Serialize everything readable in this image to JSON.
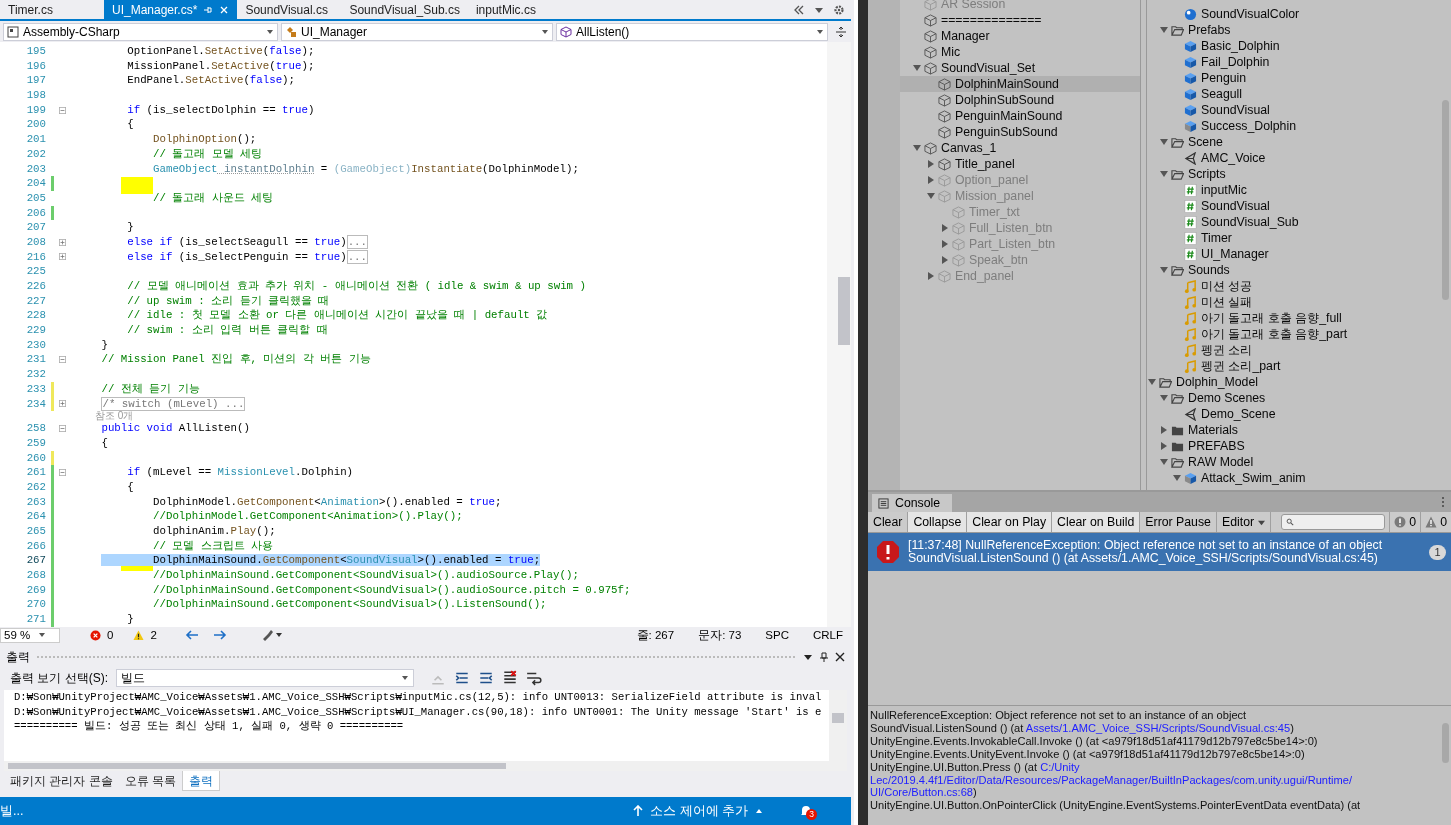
{
  "editor_tabs": [
    {
      "label": "Timer.cs",
      "selected": false
    },
    {
      "label": "UI_Manager.cs*",
      "selected": true
    },
    {
      "label": "SoundVisual.cs",
      "selected": false
    },
    {
      "label": "SoundVisual_Sub.cs",
      "selected": false
    },
    {
      "label": "inputMic.cs",
      "selected": false
    }
  ],
  "nav_bar": {
    "project": "Assembly-CSharp",
    "class": "UI_Manager",
    "member": "AllListen()"
  },
  "code": {
    "lines": [
      {
        "number": "195",
        "selected": false,
        "marked": false,
        "tokens": [
          {
            "kind": "p",
            "text": "    OptionPanel."
          },
          {
            "kind": "m",
            "text": "SetActive"
          },
          {
            "kind": "p",
            "text": "("
          },
          {
            "kind": "k",
            "text": "false"
          },
          {
            "kind": "p",
            "text": ");"
          }
        ]
      },
      {
        "number": "196",
        "selected": false,
        "marked": false,
        "tokens": [
          {
            "kind": "p",
            "text": "    MissionPanel."
          },
          {
            "kind": "m",
            "text": "SetActive"
          },
          {
            "kind": "p",
            "text": "("
          },
          {
            "kind": "k",
            "text": "true"
          },
          {
            "kind": "p",
            "text": ");"
          }
        ]
      },
      {
        "number": "197",
        "selected": false,
        "marked": false,
        "tokens": [
          {
            "kind": "p",
            "text": "    EndPanel."
          },
          {
            "kind": "m",
            "text": "SetActive"
          },
          {
            "kind": "p",
            "text": "("
          },
          {
            "kind": "k",
            "text": "false"
          },
          {
            "kind": "p",
            "text": ");"
          }
        ]
      },
      {
        "number": "198",
        "selected": false,
        "marked": false
      },
      {
        "number": "199",
        "selected": false,
        "marked": false,
        "collapsed": false,
        "tokens": [
          {
            "kind": "k",
            "text": "    if"
          },
          {
            "kind": "p",
            "text": " (is_selectDolphin == "
          },
          {
            "kind": "k",
            "text": "true"
          },
          {
            "kind": "p",
            "text": ")"
          }
        ]
      },
      {
        "number": "200",
        "selected": false,
        "marked": false,
        "tokens": [
          {
            "kind": "p",
            "text": "    {"
          }
        ]
      },
      {
        "number": "201",
        "selected": false,
        "marked": false,
        "tokens": [
          {
            "kind": "m",
            "text": "        DolphinOption"
          },
          {
            "kind": "p",
            "text": "();"
          }
        ]
      },
      {
        "number": "202",
        "selected": false,
        "marked": false,
        "tokens": [
          {
            "kind": "c",
            "text": "        // 돌고래 모델 세팅"
          }
        ]
      },
      {
        "number": "203",
        "selected": false,
        "marked": false,
        "tokens": [
          {
            "kind": "t",
            "text": "        GameObject"
          },
          {
            "kind": "u",
            "text": " instantDolphin"
          },
          {
            "kind": "p",
            "text": " = "
          },
          {
            "kind": "f",
            "text": "(GameObject)"
          },
          {
            "kind": "m",
            "text": "Instantiate"
          },
          {
            "kind": "p",
            "text": "(DolphinModel);"
          }
        ]
      },
      {
        "number": "204",
        "selected": false,
        "marked": true,
        "saved": true
      },
      {
        "number": "205",
        "selected": false,
        "marked": false,
        "tokens": [
          {
            "kind": "c",
            "text": "        // 돌고래 사운드 세팅"
          }
        ]
      },
      {
        "number": "206",
        "selected": false,
        "marked": false,
        "saved": true
      },
      {
        "number": "207",
        "selected": false,
        "marked": false,
        "tokens": [
          {
            "kind": "p",
            "text": "    }"
          }
        ]
      },
      {
        "number": "208",
        "selected": false,
        "marked": false,
        "collapsed": true,
        "tokens": [
          {
            "kind": "k",
            "text": "    else if"
          },
          {
            "kind": "p",
            "text": " (is_selectSeagull == "
          },
          {
            "kind": "k",
            "text": "true"
          },
          {
            "kind": "p",
            "text": ")"
          },
          {
            "kind": "x",
            "text": "..."
          }
        ]
      },
      {
        "number": "216",
        "selected": false,
        "marked": false,
        "collapsed": true,
        "tokens": [
          {
            "kind": "k",
            "text": "    else if"
          },
          {
            "kind": "p",
            "text": " (is_SelectPenguin == "
          },
          {
            "kind": "k",
            "text": "true"
          },
          {
            "kind": "p",
            "text": ")"
          },
          {
            "kind": "x",
            "text": "..."
          }
        ]
      },
      {
        "number": "225",
        "selected": false,
        "marked": false
      },
      {
        "number": "226",
        "selected": false,
        "marked": false,
        "tokens": [
          {
            "kind": "c",
            "text": "    // 모델 애니메이션 효과 추가 위치 - 애니메이션 전환 ( idle & swim & up swim )"
          }
        ]
      },
      {
        "number": "227",
        "selected": false,
        "marked": false,
        "tokens": [
          {
            "kind": "c",
            "text": "    // up swim : 소리 듣기 클릭했을 때"
          }
        ]
      },
      {
        "number": "228",
        "selected": false,
        "marked": false,
        "tokens": [
          {
            "kind": "c",
            "text": "    // idle : 첫 모델 소환 or 다른 애니메이션 시간이 끝났을 때 | default 값"
          }
        ]
      },
      {
        "number": "229",
        "selected": false,
        "marked": false,
        "tokens": [
          {
            "kind": "c",
            "text": "    // swim : 소리 입력 버튼 클릭할 때"
          }
        ]
      },
      {
        "number": "230",
        "selected": false,
        "marked": false,
        "tokens": [
          {
            "kind": "p",
            "text": "}"
          }
        ]
      },
      {
        "number": "231",
        "selected": false,
        "marked": false,
        "collapsed": false,
        "tokens": [
          {
            "kind": "c",
            "text": "// Mission Panel 진입 후, 미션의 각 버튼 기능"
          }
        ]
      },
      {
        "number": "232",
        "selected": false,
        "marked": false
      },
      {
        "number": "233",
        "selected": false,
        "marked": false,
        "saved": false,
        "tokens": [
          {
            "kind": "c",
            "text": "// 전체 듣기 기능"
          }
        ]
      },
      {
        "number": "234",
        "selected": false,
        "marked": false,
        "saved": false,
        "collapsed": true,
        "tokens": [
          {
            "kind": "x",
            "text": "/* switch (mLevel) ..."
          }
        ]
      },
      {
        "number": "258",
        "selected": false,
        "marked": false,
        "collapsed": false,
        "codelens": "참조 0개",
        "tokens": [
          {
            "kind": "k",
            "text": "public void"
          },
          {
            "kind": "p",
            "text": " AllListen()"
          }
        ]
      },
      {
        "number": "259",
        "selected": false,
        "marked": false,
        "tokens": [
          {
            "kind": "p",
            "text": "{"
          }
        ]
      },
      {
        "number": "260",
        "selected": false,
        "marked": false,
        "saved": false
      },
      {
        "number": "261",
        "selected": false,
        "marked": false,
        "saved": true,
        "collapsed": false,
        "tokens": [
          {
            "kind": "k",
            "text": "    if"
          },
          {
            "kind": "p",
            "text": " (mLevel == "
          },
          {
            "kind": "t",
            "text": "MissionLevel"
          },
          {
            "kind": "p",
            "text": ".Dolphin)"
          }
        ]
      },
      {
        "number": "262",
        "selected": false,
        "marked": false,
        "saved": true,
        "tokens": [
          {
            "kind": "p",
            "text": "    {"
          }
        ]
      },
      {
        "number": "263",
        "selected": false,
        "marked": false,
        "saved": true,
        "tokens": [
          {
            "kind": "p",
            "text": "        DolphinModel."
          },
          {
            "kind": "m",
            "text": "GetComponent"
          },
          {
            "kind": "p",
            "text": "<"
          },
          {
            "kind": "t",
            "text": "Animation"
          },
          {
            "kind": "p",
            "text": ">().enabled = "
          },
          {
            "kind": "k",
            "text": "true"
          },
          {
            "kind": "p",
            "text": ";"
          }
        ]
      },
      {
        "number": "264",
        "selected": false,
        "marked": false,
        "saved": true,
        "tokens": [
          {
            "kind": "c",
            "text": "        //DolphinModel.GetComponent<Animation>().Play();"
          }
        ]
      },
      {
        "number": "265",
        "selected": false,
        "marked": false,
        "saved": true,
        "tokens": [
          {
            "kind": "p",
            "text": "        dolphinAnim."
          },
          {
            "kind": "m",
            "text": "Play"
          },
          {
            "kind": "p",
            "text": "();"
          }
        ]
      },
      {
        "number": "266",
        "selected": false,
        "marked": false,
        "saved": true,
        "tokens": [
          {
            "kind": "c",
            "text": "        // 모델 스크립트 사용"
          }
        ]
      },
      {
        "number": "267",
        "selected": true,
        "marked": true,
        "saved": true,
        "tokens": [
          {
            "kind": "p",
            "text": "        DolphinMainSound."
          },
          {
            "kind": "m",
            "text": "GetComponent"
          },
          {
            "kind": "p",
            "text": "<"
          },
          {
            "kind": "t",
            "text": "SoundVisual"
          },
          {
            "kind": "p",
            "text": ">().enabled = "
          },
          {
            "kind": "k",
            "text": "true"
          },
          {
            "kind": "p",
            "text": ";"
          }
        ]
      },
      {
        "number": "268",
        "selected": false,
        "marked": false,
        "saved": true,
        "tokens": [
          {
            "kind": "c",
            "text": "        //DolphinMainSound.GetComponent<SoundVisual>().audioSource.Play();"
          }
        ]
      },
      {
        "number": "269",
        "selected": false,
        "marked": false,
        "saved": true,
        "tokens": [
          {
            "kind": "c",
            "text": "        //DolphinMainSound.GetComponent<SoundVisual>().audioSource.pitch = 0.975f;"
          }
        ]
      },
      {
        "number": "270",
        "selected": false,
        "marked": false,
        "saved": true,
        "tokens": [
          {
            "kind": "c",
            "text": "        //DolphinMainSound.GetComponent<SoundVisual>().ListenSound();"
          }
        ]
      },
      {
        "number": "271",
        "selected": false,
        "marked": false,
        "saved": true,
        "tokens": [
          {
            "kind": "p",
            "text": "    }"
          }
        ]
      }
    ]
  },
  "editor_status": {
    "zoom": "59 %",
    "errors": "0",
    "warnings": "2",
    "line": "줄: 267",
    "column": "문자: 73",
    "spacing": "SPC",
    "line_ending": "CRLF"
  },
  "output": {
    "title": "출력",
    "source_label": "출력 보기 선택(S):",
    "source": "빌드",
    "lines": [
      "D:₩Son₩UnityProject₩AMC_Voice₩Assets₩1.AMC_Voice_SSH₩Scripts₩inputMic.cs(12,5): info UNT0013: SerializeField attribute is inval",
      "D:₩Son₩UnityProject₩AMC_Voice₩Assets₩1.AMC_Voice_SSH₩Scripts₩UI_Manager.cs(90,18): info UNT0001: The Unity message 'Start' is e",
      "========== 빌드: 성공 또는 최신 상태 1, 실패 0, 생략 0 =========="
    ],
    "tabs": [
      {
        "label": "패키지 관리자 콘솔",
        "selected": false
      },
      {
        "label": "오류 목록",
        "selected": false
      },
      {
        "label": "출력",
        "selected": true
      }
    ]
  },
  "status_bar": {
    "message": "빌...",
    "source_control": "소스 제어에 추가",
    "notifications": "3"
  },
  "hierarchy": {
    "tree": [
      {
        "children": [
          {
            "name": "AR Session",
            "active": false,
            "selected": false
          },
          {
            "name": "==============",
            "active": true,
            "selected": false
          },
          {
            "name": "Manager",
            "active": true,
            "selected": false
          },
          {
            "name": "Mic",
            "active": true,
            "selected": false
          },
          {
            "name": "SoundVisual_Set",
            "active": true,
            "selected": false,
            "expanded": true,
            "children": [
              {
                "name": "DolphinMainSound",
                "active": true,
                "selected": true
              },
              {
                "name": "DolphinSubSound",
                "active": true,
                "selected": false
              },
              {
                "name": "PenguinMainSound",
                "active": true,
                "selected": false
              },
              {
                "name": "PenguinSubSound",
                "active": true,
                "selected": false
              }
            ]
          },
          {
            "name": "Canvas_1",
            "active": true,
            "selected": false,
            "expanded": true,
            "children": [
              {
                "name": "Title_panel",
                "active": true,
                "selected": false,
                "expanded": false
              },
              {
                "name": "Option_panel",
                "active": false,
                "selected": false,
                "expanded": false
              },
              {
                "name": "Mission_panel",
                "active": false,
                "selected": false,
                "expanded": true,
                "children": [
                  {
                    "name": "Timer_txt",
                    "active": false,
                    "selected": false
                  },
                  {
                    "name": "Full_Listen_btn",
                    "active": false,
                    "selected": false,
                    "expanded": false
                  },
                  {
                    "name": "Part_Listen_btn",
                    "active": false,
                    "selected": false,
                    "expanded": false
                  },
                  {
                    "name": "Speak_btn",
                    "active": false,
                    "selected": false,
                    "expanded": false
                  }
                ]
              },
              {
                "name": "End_panel",
                "active": false,
                "selected": false,
                "expanded": false
              }
            ]
          }
        ]
      }
    ]
  },
  "project": {
    "tree": [
      {
        "children": [
          {
            "children": [
              {
                "kind": "material",
                "name": "SoundVisualColor"
              }
            ]
          },
          {
            "kind": "folder",
            "name": "Prefabs",
            "expanded": true,
            "children": [
              {
                "kind": "prefab",
                "name": "Basic_Dolphin"
              },
              {
                "kind": "prefab",
                "name": "Fail_Dolphin"
              },
              {
                "kind": "prefab",
                "name": "Penguin"
              },
              {
                "kind": "prefab",
                "name": "Seagull"
              },
              {
                "kind": "prefab",
                "name": "SoundVisual"
              },
              {
                "kind": "model",
                "name": "Success_Dolphin"
              }
            ]
          },
          {
            "kind": "folder",
            "name": "Scene",
            "expanded": true,
            "children": [
              {
                "kind": "scene",
                "name": "AMC_Voice"
              }
            ]
          },
          {
            "kind": "folder",
            "name": "Scripts",
            "expanded": true,
            "children": [
              {
                "kind": "script",
                "name": "inputMic"
              },
              {
                "kind": "script",
                "name": "SoundVisual"
              },
              {
                "kind": "script",
                "name": "SoundVisual_Sub"
              },
              {
                "kind": "script",
                "name": "Timer"
              },
              {
                "kind": "script",
                "name": "UI_Manager"
              }
            ]
          },
          {
            "kind": "folder",
            "name": "Sounds",
            "expanded": true,
            "children": [
              {
                "kind": "audio",
                "name": "미션 성공"
              },
              {
                "kind": "audio",
                "name": "미션 실패"
              },
              {
                "kind": "audio",
                "name": "아기 돌고래 호출 음향_full"
              },
              {
                "kind": "audio",
                "name": "아기 돌고래 호출 음향_part"
              },
              {
                "kind": "audio",
                "name": "펭귄 소리"
              },
              {
                "kind": "audio",
                "name": "펭귄 소리_part"
              }
            ]
          }
        ]
      },
      {
        "kind": "folder",
        "name": "Dolphin_Model",
        "expanded": true,
        "children": [
          {
            "kind": "folder",
            "name": "Demo Scenes",
            "expanded": true,
            "children": [
              {
                "kind": "scene",
                "name": "Demo_Scene"
              }
            ]
          },
          {
            "kind": "folder",
            "name": "Materials",
            "expanded": false
          },
          {
            "kind": "folder",
            "name": "PREFABS",
            "expanded": false
          },
          {
            "kind": "folder",
            "name": "RAW Model",
            "expanded": true,
            "children": [
              {
                "kind": "model",
                "name": "Attack_Swim_anim",
                "expanded": true
              }
            ]
          }
        ]
      }
    ]
  },
  "console": {
    "title": "Console",
    "toolbar": [
      {
        "label": "Clear",
        "kind": "button",
        "on": false
      },
      {
        "label": "Collapse",
        "kind": "toggle",
        "on": true
      },
      {
        "label": "Clear on Play",
        "kind": "toggle",
        "on": true
      },
      {
        "label": "Clear on Build",
        "kind": "toggle",
        "on": true
      },
      {
        "label": "Error Pause",
        "kind": "toggle",
        "on": false
      },
      {
        "label": "Editor",
        "kind": "dropdown",
        "on": false
      }
    ],
    "counters": [
      {
        "kind": "error",
        "count": "0"
      },
      {
        "kind": "warning",
        "count": "0"
      }
    ],
    "entries": [
      {
        "kind": "error",
        "selected": true,
        "message": "[11:37:48] NullReferenceException: Object reference not set to an instance of an object",
        "location": "SoundVisual.ListenSound () (at Assets/1.AMC_Voice_SSH/Scripts/SoundVisual.cs:45)",
        "count": "1"
      }
    ],
    "details": [
      [
        {
          "text": "NullReferenceException: Object reference not set to an instance of an object",
          "link": false
        }
      ],
      [
        {
          "text": "SoundVisual.ListenSound () (at ",
          "link": false
        },
        {
          "text": "Assets/1.AMC_Voice_SSH/Scripts/SoundVisual.cs:45",
          "link": true
        },
        {
          "text": ")",
          "link": false
        }
      ],
      [
        {
          "text": "UnityEngine.Events.InvokableCall.Invoke () (at <a979f18d51af41179d12b797e8c5be14>:0)",
          "link": false
        }
      ],
      [
        {
          "text": "UnityEngine.Events.UnityEvent.Invoke () (at <a979f18d51af41179d12b797e8c5be14>:0)",
          "link": false
        }
      ],
      [
        {
          "text": "UnityEngine.UI.Button.Press () (at ",
          "link": false
        },
        {
          "text": "C:/Unity",
          "link": true
        }
      ],
      [
        {
          "text": "Lec/2019.4.4f1/Editor/Data/Resources/PackageManager/BuiltInPackages/com.unity.ugui/Runtime/",
          "link": true
        }
      ],
      [
        {
          "text": "UI/Core/Button.cs:68",
          "link": true
        },
        {
          "text": ")",
          "link": false
        }
      ],
      [
        {
          "text": "UnityEngine.UI.Button.OnPointerClick (UnityEngine.EventSystems.PointerEventData eventData) (at",
          "link": false
        }
      ]
    ]
  }
}
